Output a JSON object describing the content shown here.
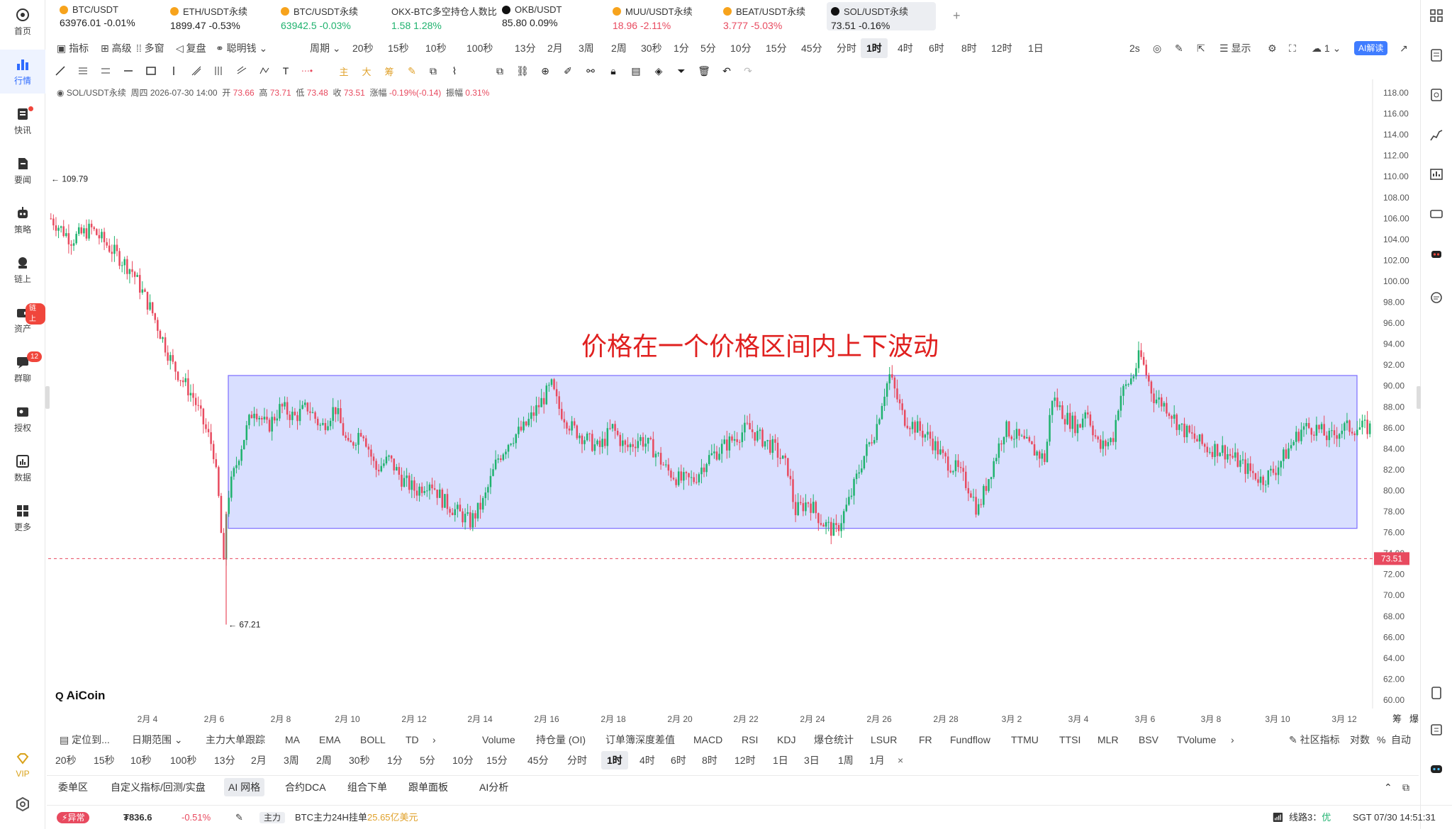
{
  "sidebar": {
    "items": [
      {
        "label": "首页",
        "icon": "home-icon"
      },
      {
        "label": "行情",
        "icon": "market-chart-icon",
        "active": true
      },
      {
        "label": "快讯",
        "icon": "news-flash-icon",
        "dot": true
      },
      {
        "label": "要闻",
        "icon": "document-icon"
      },
      {
        "label": "策略",
        "icon": "robot-icon"
      },
      {
        "label": "链上",
        "icon": "chain-icon"
      },
      {
        "label": "资产",
        "icon": "wallet-icon",
        "badge": "链上"
      },
      {
        "label": "群聊",
        "icon": "chat-icon",
        "badge": "12"
      },
      {
        "label": "授权",
        "icon": "authorize-icon"
      },
      {
        "label": "数据",
        "icon": "data-icon"
      },
      {
        "label": "更多",
        "icon": "more-grid-icon"
      }
    ],
    "vip": "VIP"
  },
  "tickers": [
    {
      "name": "BTC/USDT",
      "value": "63976.01",
      "change": "-0.01%",
      "dir": "down"
    },
    {
      "name": "ETH/USDT永续",
      "value": "1899.47",
      "change": "-0.53%",
      "dir": "down"
    },
    {
      "name": "BTC/USDT永续",
      "value": "63942.5",
      "change": "-0.03%",
      "dir": "up"
    },
    {
      "name": "OKX-BTC多空持仓人数比",
      "value": "1.58",
      "change": "1.28%",
      "dir": "up"
    },
    {
      "name": "OKB/USDT",
      "value": "85.80",
      "change": "0.09%",
      "dir": "neutral"
    },
    {
      "name": "MUU/USDT永续",
      "value": "18.96",
      "change": "-2.11%",
      "dir": "red"
    },
    {
      "name": "BEAT/USDT永续",
      "value": "3.777",
      "change": "-5.03%",
      "dir": "red"
    },
    {
      "name": "SOL/USDT永续",
      "value": "73.51",
      "change": "-0.16%",
      "dir": "neutral",
      "active": true
    }
  ],
  "toolbar1": {
    "indicator": "指标",
    "advanced": "高级",
    "multi_window": "多窗",
    "replay": "复盘",
    "smart_money": "聪明钱",
    "period": "周期",
    "periods": [
      "20秒",
      "15秒",
      "10秒",
      "100秒",
      "13分",
      "2月",
      "3周",
      "2周",
      "30秒",
      "1分",
      "5分",
      "10分",
      "15分",
      "45分",
      "分时",
      "1时",
      "4时",
      "6时",
      "8时",
      "12时",
      "1日"
    ],
    "selected_period": "1时",
    "refresh": "2s",
    "display": "显示",
    "layout_count": "1",
    "ai_interpret": "AI解读"
  },
  "legend": {
    "symbol": "SOL/USDT永续",
    "date": "周四 2026-07-30 14:00",
    "open_label": "开",
    "open": "73.66",
    "high_label": "高",
    "high": "73.71",
    "low_label": "低",
    "low": "73.48",
    "close_label": "收",
    "close": "73.51",
    "change_label": "涨幅",
    "change": "-0.19%(-0.14)",
    "amp_label": "振幅",
    "amp": "0.31%"
  },
  "annotation": "价格在一个价格区间内上下波动",
  "brand": "AiCoin",
  "chart_data": {
    "type": "candlestick",
    "y_ticks": [
      "118.00",
      "116.00",
      "114.00",
      "112.00",
      "110.00",
      "108.00",
      "106.00",
      "104.00",
      "102.00",
      "100.00",
      "98.00",
      "96.00",
      "94.00",
      "92.00",
      "90.00",
      "88.00",
      "86.00",
      "84.00",
      "82.00",
      "80.00",
      "78.00",
      "76.00",
      "74.00",
      "72.00",
      "70.00",
      "68.00",
      "66.00",
      "64.00",
      "62.00",
      "60.00"
    ],
    "ylim": [
      60,
      118
    ],
    "x_ticks": [
      "2月 4",
      "2月 6",
      "2月 8",
      "2月 10",
      "2月 12",
      "2月 14",
      "2月 16",
      "2月 18",
      "2月 20",
      "2月 22",
      "2月 24",
      "2月 26",
      "2月 28",
      "3月 2",
      "3月 4",
      "3月 6",
      "3月 8",
      "3月 10",
      "3月 12"
    ],
    "high_mark": "109.79",
    "low_mark": "67.21",
    "last_price": "73.51",
    "range_box": {
      "low": 76.4,
      "high": 91.0
    },
    "path_points": [
      [
        0,
        106
      ],
      [
        3,
        104
      ],
      [
        6,
        105
      ],
      [
        9,
        103
      ],
      [
        12,
        101
      ],
      [
        15,
        97
      ],
      [
        18,
        92
      ],
      [
        21,
        89
      ],
      [
        24,
        84
      ],
      [
        25,
        78
      ],
      [
        25.5,
        72
      ],
      [
        26,
        79
      ],
      [
        28,
        84
      ],
      [
        30,
        88
      ],
      [
        32,
        86
      ],
      [
        34,
        88
      ],
      [
        36,
        87
      ],
      [
        38,
        88
      ],
      [
        40,
        86
      ],
      [
        42,
        88
      ],
      [
        44,
        84
      ],
      [
        46,
        86
      ],
      [
        48,
        82
      ],
      [
        50,
        83
      ],
      [
        52,
        81
      ],
      [
        54,
        80
      ],
      [
        56,
        81
      ],
      [
        58,
        79
      ],
      [
        60,
        78
      ],
      [
        62,
        77
      ],
      [
        64,
        79
      ],
      [
        66,
        83
      ],
      [
        68,
        85
      ],
      [
        70,
        86
      ],
      [
        72,
        88
      ],
      [
        74,
        90
      ],
      [
        75,
        88
      ],
      [
        77,
        86
      ],
      [
        79,
        85
      ],
      [
        81,
        84
      ],
      [
        83,
        86
      ],
      [
        85,
        84
      ],
      [
        87,
        85
      ],
      [
        89,
        84
      ],
      [
        91,
        82
      ],
      [
        93,
        81
      ],
      [
        95,
        81
      ],
      [
        97,
        83
      ],
      [
        99,
        84
      ],
      [
        101,
        85
      ],
      [
        103,
        86
      ],
      [
        105,
        85
      ],
      [
        107,
        84
      ],
      [
        109,
        82
      ],
      [
        110,
        78
      ],
      [
        112,
        79
      ],
      [
        114,
        77
      ],
      [
        116,
        76
      ],
      [
        118,
        79
      ],
      [
        120,
        83
      ],
      [
        122,
        86
      ],
      [
        123,
        89
      ],
      [
        124,
        91
      ],
      [
        126,
        87
      ],
      [
        128,
        86
      ],
      [
        130,
        85
      ],
      [
        132,
        83
      ],
      [
        134,
        82
      ],
      [
        136,
        80
      ],
      [
        137,
        78
      ],
      [
        139,
        82
      ],
      [
        141,
        86
      ],
      [
        143,
        85
      ],
      [
        145,
        84
      ],
      [
        147,
        83
      ],
      [
        148,
        89
      ],
      [
        150,
        87
      ],
      [
        152,
        86
      ],
      [
        153,
        88
      ],
      [
        155,
        84
      ],
      [
        157,
        85
      ],
      [
        158,
        89
      ],
      [
        160,
        91
      ],
      [
        161,
        93
      ],
      [
        163,
        89
      ],
      [
        165,
        88
      ],
      [
        167,
        86
      ],
      [
        169,
        85
      ],
      [
        171,
        84
      ],
      [
        173,
        84
      ],
      [
        175,
        83
      ],
      [
        177,
        82
      ],
      [
        179,
        81
      ],
      [
        181,
        82
      ],
      [
        183,
        84
      ],
      [
        185,
        86
      ],
      [
        187,
        86
      ],
      [
        189,
        85
      ],
      [
        191,
        86
      ],
      [
        193,
        86
      ],
      [
        195,
        86
      ]
    ],
    "x_ticks_count": 19
  },
  "indicators": {
    "locate": "定位到...",
    "date_range": "日期范围",
    "main": [
      "主力大单跟踪",
      "MA",
      "EMA",
      "BOLL",
      "TD"
    ],
    "sub": [
      "Volume",
      "持仓量 (OI)",
      "订单簿深度差值",
      "MACD",
      "RSI",
      "KDJ",
      "爆仓统计",
      "LSUR",
      "FR",
      "Fundflow",
      "TTMU",
      "TTSI",
      "MLR",
      "BSV",
      "TVolume"
    ],
    "community": "社区指标",
    "log": "对数",
    "percent": "%",
    "auto": "自动",
    "right_labels": [
      "筹",
      "爆"
    ]
  },
  "period_bar": {
    "items": [
      "20秒",
      "15秒",
      "10秒",
      "100秒",
      "13分",
      "2月",
      "3周",
      "2周",
      "30秒",
      "1分",
      "5分",
      "10分",
      "15分",
      "45分",
      "分时",
      "1时",
      "4时",
      "6时",
      "8时",
      "12时",
      "1日",
      "3日",
      "1周",
      "1月"
    ],
    "selected": "1时"
  },
  "panels": [
    "委单区",
    "自定义指标/回测/实盘",
    "AI 网格",
    "合约DCA",
    "组合下单",
    "跟单面板",
    "AI分析"
  ],
  "panels_selected": "AI 网格",
  "status": {
    "alert": "异常",
    "asset_value": "₮836.6",
    "asset_change": "-0.51%",
    "main_force": "主力",
    "main_text": "BTC主力24H挂单",
    "main_amount": "25.65亿美元",
    "line": "线路3：",
    "line_quality": "优",
    "time": "SGT 07/30 14:51:31"
  },
  "colors": {
    "up": "#1fb26e",
    "down": "#e84a5f",
    "accent": "#2f6bff",
    "box": "#7b6cff"
  }
}
